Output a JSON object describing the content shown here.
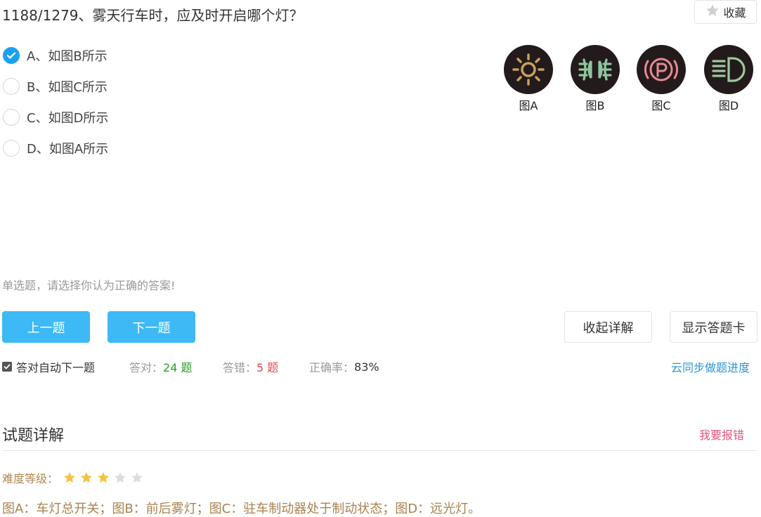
{
  "question": {
    "title": "1188/1279、雾天行车时，应及时开启哪个灯？"
  },
  "favorite": {
    "label": "收藏",
    "icon": "star-icon"
  },
  "options": [
    {
      "label": "A、如图B所示",
      "selected": true
    },
    {
      "label": "B、如图C所示",
      "selected": false
    },
    {
      "label": "C、如图D所示",
      "selected": false
    },
    {
      "label": "D、如图A所示",
      "selected": false
    }
  ],
  "figures": [
    {
      "caption": "图A",
      "icon": "headlight-switch-icon",
      "color": "#c8a15a"
    },
    {
      "caption": "图B",
      "icon": "fog-light-icon",
      "color": "#8fc6a0"
    },
    {
      "caption": "图C",
      "icon": "parking-brake-icon",
      "color": "#e58a92"
    },
    {
      "caption": "图D",
      "icon": "high-beam-icon",
      "color": "#9fc79a"
    }
  ],
  "hint": "单选题，请选择你认为正确的答案!",
  "nav": {
    "prev": "上一题",
    "next": "下一题",
    "collapse": "收起详解",
    "answer_card": "显示答题卡"
  },
  "stats": {
    "auto_next_label": "答对自动下一题",
    "auto_next_checked": true,
    "correct_label": "答对：",
    "correct_value": "24 题",
    "wrong_label": "答错：",
    "wrong_value": "5 题",
    "accuracy_label": "正确率：",
    "accuracy_value": "83%",
    "sync_link": "云同步做题进度"
  },
  "detail": {
    "title": "试题详解",
    "report": "我要报错",
    "difficulty_label": "难度等级：",
    "difficulty_stars": 3,
    "difficulty_max": 5,
    "explanation": "图A：车灯总开关；图B：前后雾灯；图C：驻车制动器处于制动状态；图D：远光灯。"
  },
  "colors": {
    "accent": "#1aa0ef",
    "button": "#3db9f6",
    "correct": "#2a9d26",
    "wrong": "#e24b4b",
    "star_on": "#f5c342",
    "star_off": "#dddddd"
  }
}
